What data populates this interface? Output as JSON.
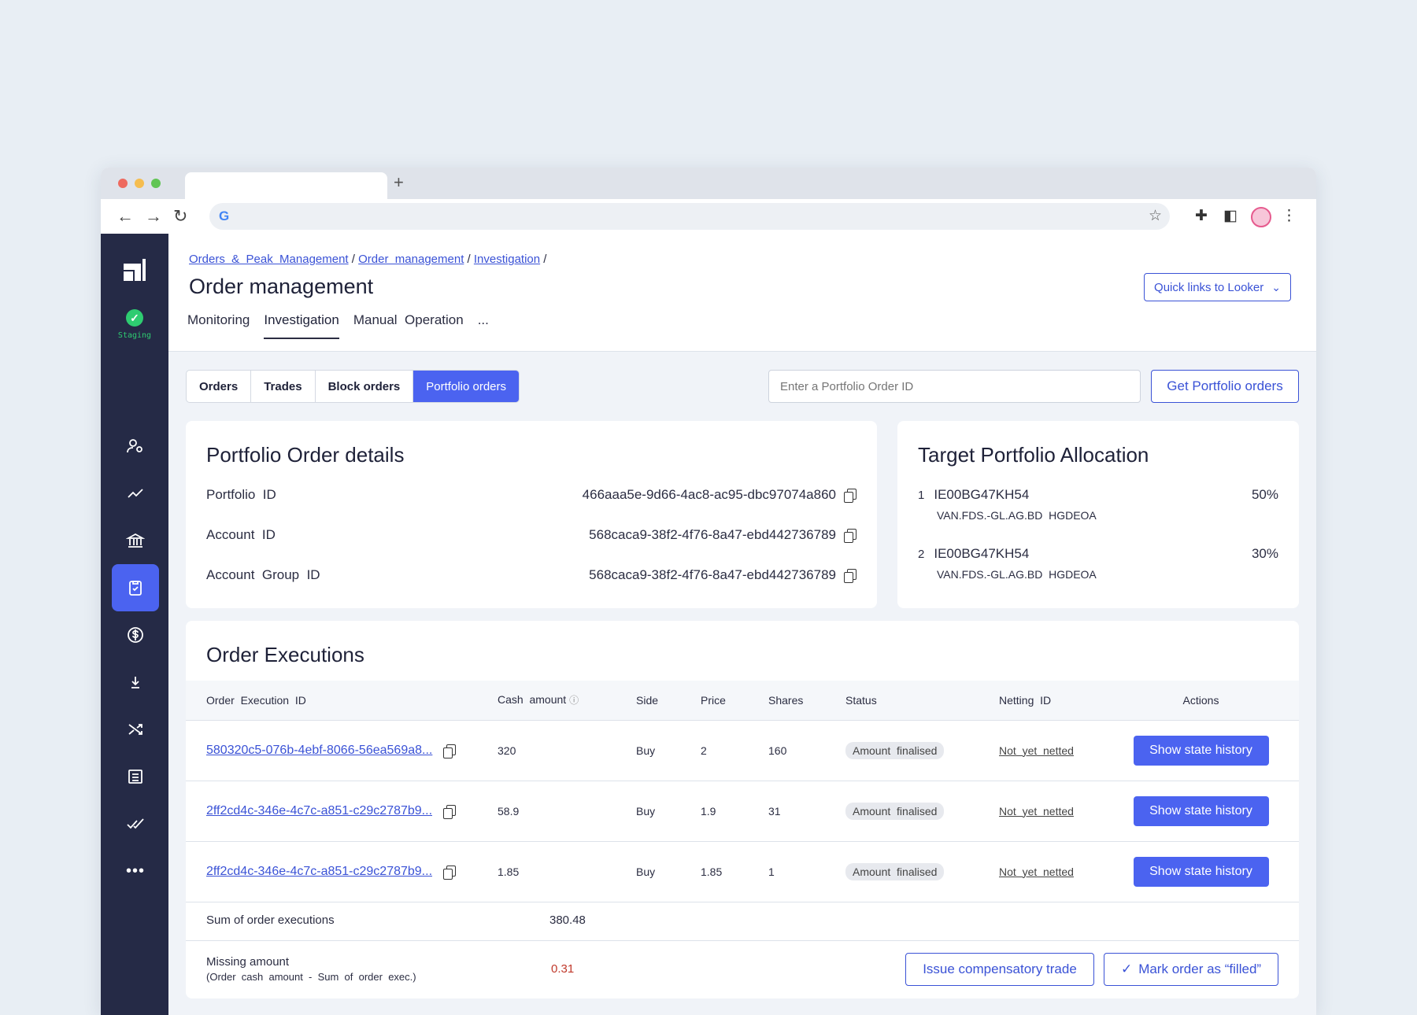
{
  "browser": {
    "colors": {
      "red": "#ee6a5f",
      "yellow": "#f5bd4f",
      "green": "#61c554"
    },
    "new_tab": "+"
  },
  "sidebar": {
    "staging_label": "Staging"
  },
  "breadcrumb": {
    "items": [
      "Orders  &  Peak  Management",
      "Order  management",
      "Investigation"
    ],
    "sep": " / "
  },
  "page": {
    "title": "Order management",
    "looker_button": "Quick links to Looker"
  },
  "tabs": [
    "Monitoring",
    "Investigation",
    "Manual  Operation",
    "..."
  ],
  "segments": [
    "Orders",
    "Trades",
    "Block orders",
    "Portfolio orders"
  ],
  "search": {
    "placeholder": "Enter a Portfolio Order ID",
    "button": "Get Portfolio orders"
  },
  "details": {
    "title": "Portfolio Order details",
    "rows": [
      {
        "label": "Portfolio  ID",
        "value": "466aaa5e-9d66-4ac8-ac95-dbc97074a860"
      },
      {
        "label": "Account  ID",
        "value": "568caca9-38f2-4f76-8a47-ebd442736789"
      },
      {
        "label": "Account  Group  ID",
        "value": "568caca9-38f2-4f76-8a47-ebd442736789"
      }
    ]
  },
  "allocation": {
    "title": "Target Portfolio Allocation",
    "items": [
      {
        "n": "1",
        "isin": "IE00BG47KH54",
        "pct": "50%",
        "sub": "VAN.FDS.-GL.AG.BD  HGDEOA"
      },
      {
        "n": "2",
        "isin": "IE00BG47KH54",
        "pct": "30%",
        "sub": "VAN.FDS.-GL.AG.BD  HGDEOA"
      }
    ]
  },
  "executions": {
    "title": "Order Executions",
    "headers": [
      "Order  Execution  ID",
      "Cash  amount",
      "Side",
      "Price",
      "Shares",
      "Status",
      "Netting  ID",
      "Actions"
    ],
    "rows": [
      {
        "id": "580320c5-076b-4ebf-8066-56ea569a8...",
        "cash": "320",
        "side": "Buy",
        "price": "2",
        "shares": "160",
        "status": "Amount  finalised",
        "netting": "Not  yet  netted",
        "action": "Show state history"
      },
      {
        "id": "2ff2cd4c-346e-4c7c-a851-c29c2787b9...",
        "cash": "58.9",
        "side": "Buy",
        "price": "1.9",
        "shares": "31",
        "status": "Amount  finalised",
        "netting": "Not  yet  netted",
        "action": "Show state history"
      },
      {
        "id": "2ff2cd4c-346e-4c7c-a851-c29c2787b9...",
        "cash": "1.85",
        "side": "Buy",
        "price": "1.85",
        "shares": "1",
        "status": "Amount  finalised",
        "netting": "Not  yet  netted",
        "action": "Show state history"
      }
    ],
    "sum_label": "Sum of order executions",
    "sum_value": "380.48",
    "missing_label": "Missing amount",
    "missing_sub": "(Order  cash  amount  -  Sum  of  order  exec.)",
    "missing_value": "0.31",
    "compensatory_button": "Issue compensatory trade",
    "mark_button": "Mark order as “filled”"
  }
}
